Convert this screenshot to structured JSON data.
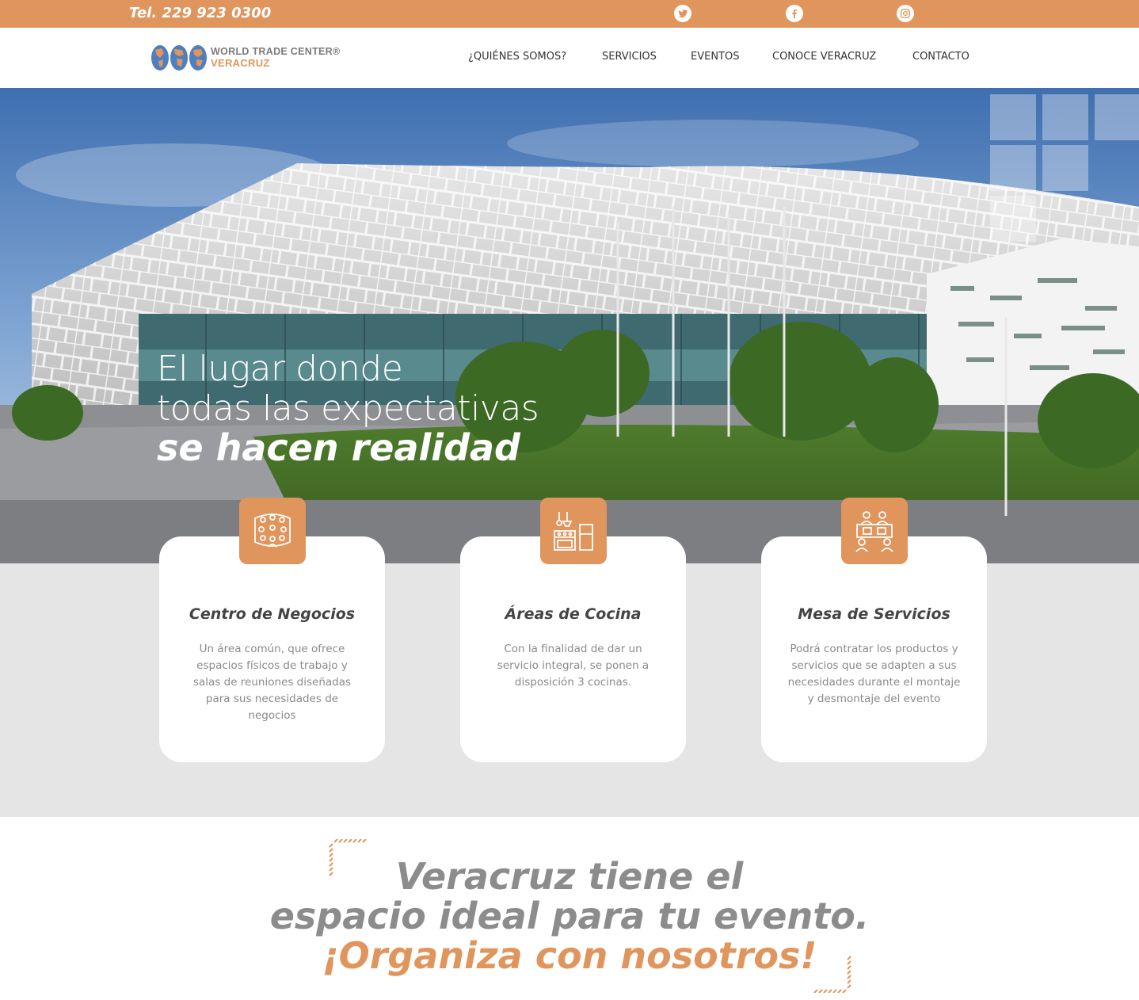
{
  "topbar": {
    "phone": "Tel. 229 923 0300",
    "social": [
      {
        "icon": "twitter-icon"
      },
      {
        "icon": "facebook-icon"
      },
      {
        "icon": "instagram-icon"
      }
    ]
  },
  "brand": {
    "line1": "WORLD TRADE CENTER®",
    "line2": "VERACRUZ"
  },
  "nav": {
    "items": [
      "¿QUIÉNES SOMOS?",
      "SERVICIOS",
      "EVENTOS",
      "CONOCE VERACRUZ",
      "CONTACTO"
    ]
  },
  "hero": {
    "line1": "El lugar donde",
    "line2": "todas las expectativas",
    "line3": "se hacen realidad"
  },
  "features": [
    {
      "icon": "auditorium-icon",
      "title": "Centro de Negocios",
      "text": "Un área común, que ofrece espacios físicos de trabajo y salas de reuniones diseñadas para sus necesidades de negocios"
    },
    {
      "icon": "kitchen-icon",
      "title": "Áreas de Cocina",
      "text": "Con la finalidad de dar un servicio integral, se ponen a disposición 3 cocinas."
    },
    {
      "icon": "meeting-table-icon",
      "title": "Mesa de Servicios",
      "text": "Podrá contratar los productos y servicios que se adapten a sus necesidades durante el montaje y desmontaje del evento"
    }
  ],
  "cta": {
    "line1": "Veracruz tiene el",
    "line2": "espacio ideal para tu evento.",
    "line3": "¡Organiza con nosotros!"
  },
  "colors": {
    "accent": "#e0955d",
    "gray_text": "#8c8c8c",
    "section_bg": "#e5e5e5"
  }
}
